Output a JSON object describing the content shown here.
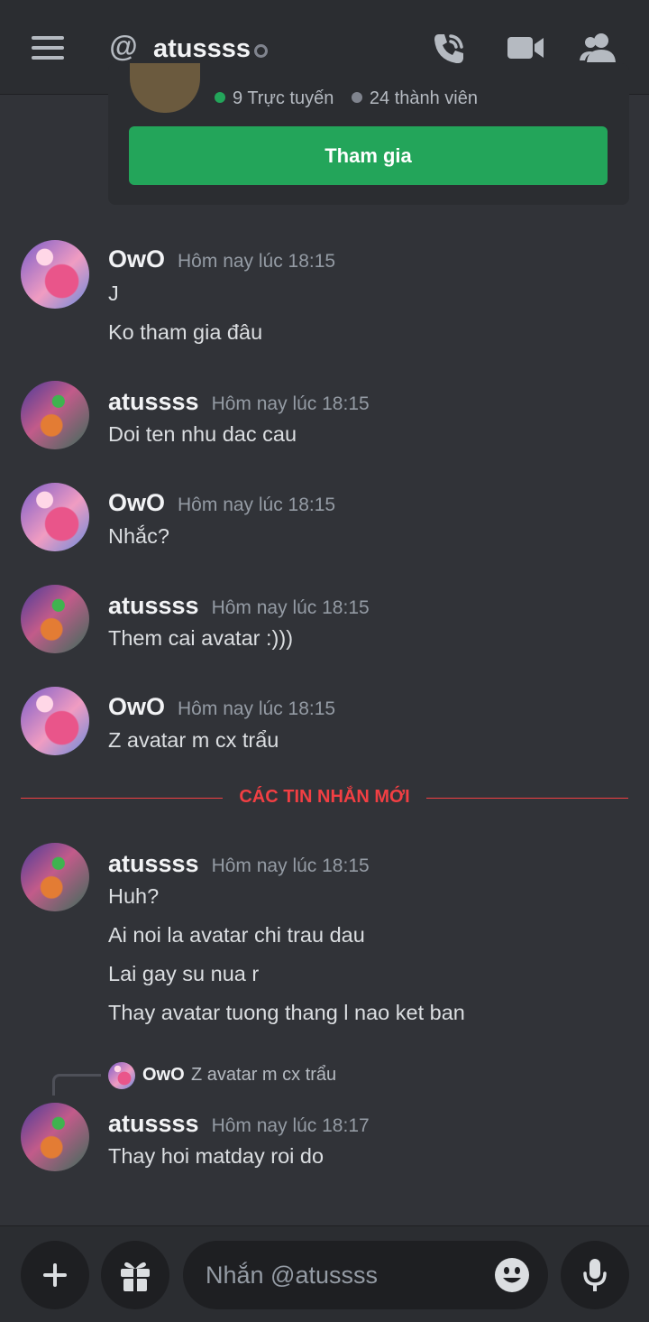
{
  "header": {
    "title": "atussss",
    "icons": [
      "menu-icon",
      "at-icon",
      "call-icon",
      "video-icon",
      "members-icon"
    ]
  },
  "invite": {
    "online": "9 Trực tuyến",
    "members": "24 thành viên",
    "join_label": "Tham gia"
  },
  "messages": [
    {
      "author": "OwO",
      "time": "Hôm nay lúc 18:15",
      "lines": [
        "J",
        "Ko tham gia đâu"
      ]
    },
    {
      "author": "atussss",
      "time": "Hôm nay lúc 18:15",
      "lines": [
        "Doi ten nhu dac cau"
      ]
    },
    {
      "author": "OwO",
      "time": "Hôm nay lúc 18:15",
      "lines": [
        "Nhắc?"
      ]
    },
    {
      "author": "atussss",
      "time": "Hôm nay lúc 18:15",
      "lines": [
        "Them cai avatar :)))"
      ]
    },
    {
      "author": "OwO",
      "time": "Hôm nay lúc 18:15",
      "lines": [
        "Z avatar m cx trẩu"
      ]
    },
    {
      "author": "atussss",
      "time": "Hôm nay lúc 18:15",
      "lines": [
        "Huh?",
        "Ai noi la avatar chi trau dau",
        "Lai gay su nua r",
        "Thay avatar tuong thang l nao ket ban"
      ]
    },
    {
      "author": "atussss",
      "time": "Hôm nay lúc 18:17",
      "lines": [
        "Thay hoi matday roi do"
      ],
      "reply_to": {
        "author": "OwO",
        "text": "Z avatar m cx trẩu"
      }
    }
  ],
  "new_messages_divider": "CÁC TIN NHẮN MỚI",
  "composer": {
    "placeholder": "Nhắn @atussss"
  },
  "colors": {
    "background": "#313338",
    "bars": "#2b2d31",
    "join_green": "#23a55a",
    "new_divider_red": "#f23f43"
  }
}
